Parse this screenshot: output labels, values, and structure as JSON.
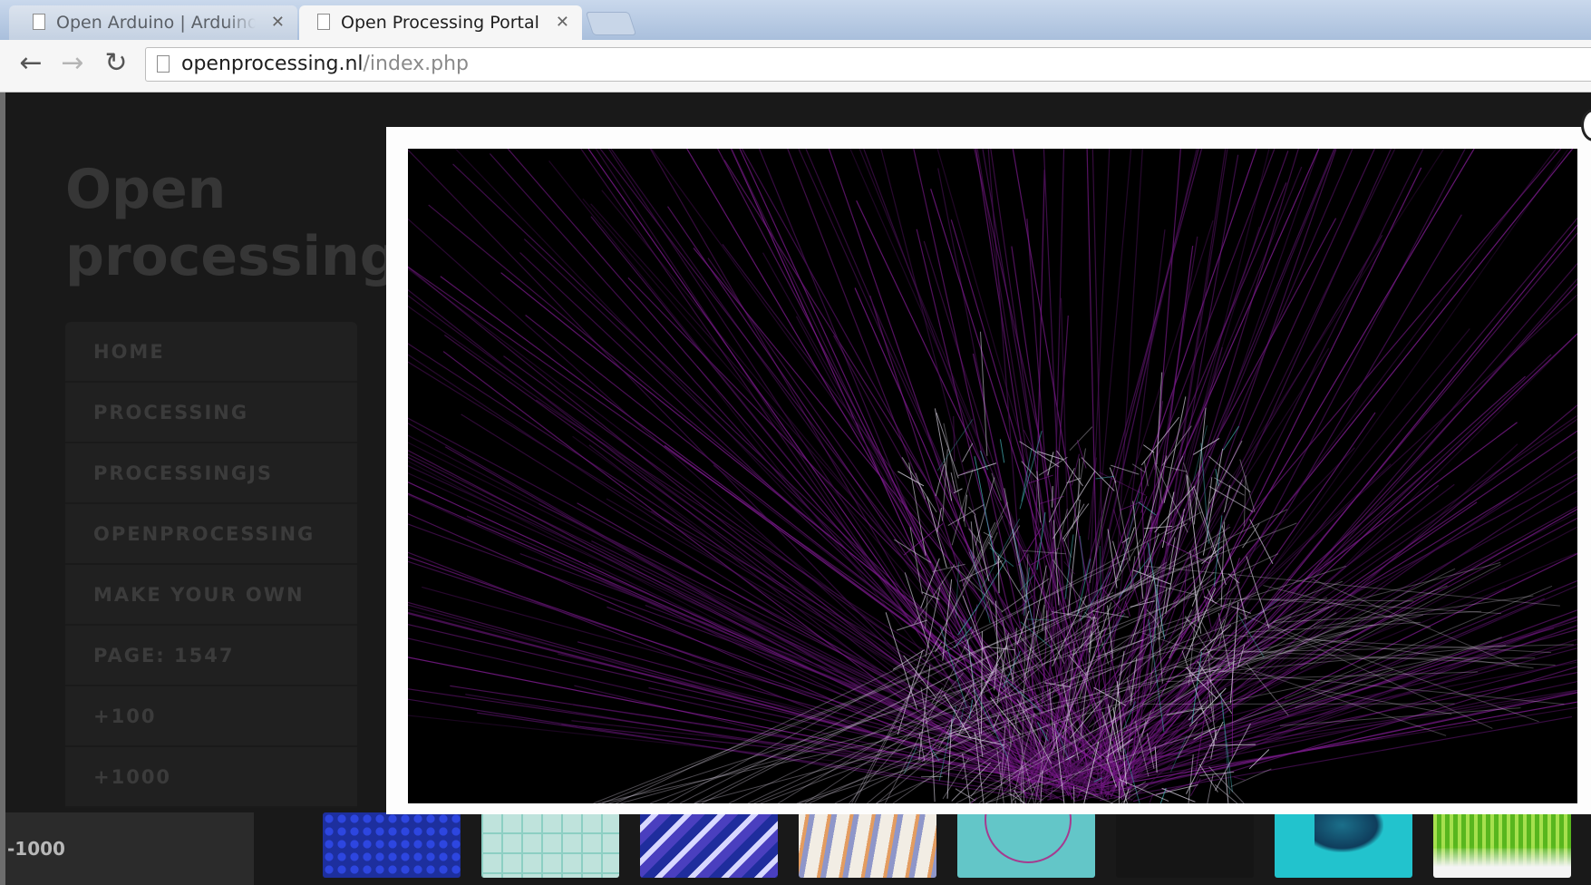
{
  "browser": {
    "tabs": [
      {
        "title": "Open Arduino | Arduino l",
        "active": false
      },
      {
        "title": "Open Processing Portal",
        "active": true
      }
    ],
    "tab_close_glyph": "✕",
    "url_host": "openprocessing.nl",
    "url_path": "/index.php",
    "icons": {
      "back": "←",
      "forward": "→",
      "reload": "↻"
    }
  },
  "site": {
    "brand_line1": "Open",
    "brand_line2": "processing",
    "nav": [
      "HOME",
      "PROCESSING",
      "PROCESSINGJS",
      "OPENPROCESSING",
      "MAKE YOUR OWN",
      "PAGE: 1547",
      "+100",
      "+1000"
    ],
    "minus_label": "-1000"
  },
  "lightbox": {
    "sketch_colors": {
      "background": "#000000",
      "rays": "#7b1a8c",
      "rays_dim": "#4a1057",
      "lines": "#d9d2e2",
      "teal": "#3fa3a8"
    }
  },
  "thumbnails": [
    "blue-dots",
    "teal-maze",
    "blue-weave",
    "orange-weave",
    "teal-circle",
    "dark",
    "cyan-blob",
    "green-grass"
  ]
}
